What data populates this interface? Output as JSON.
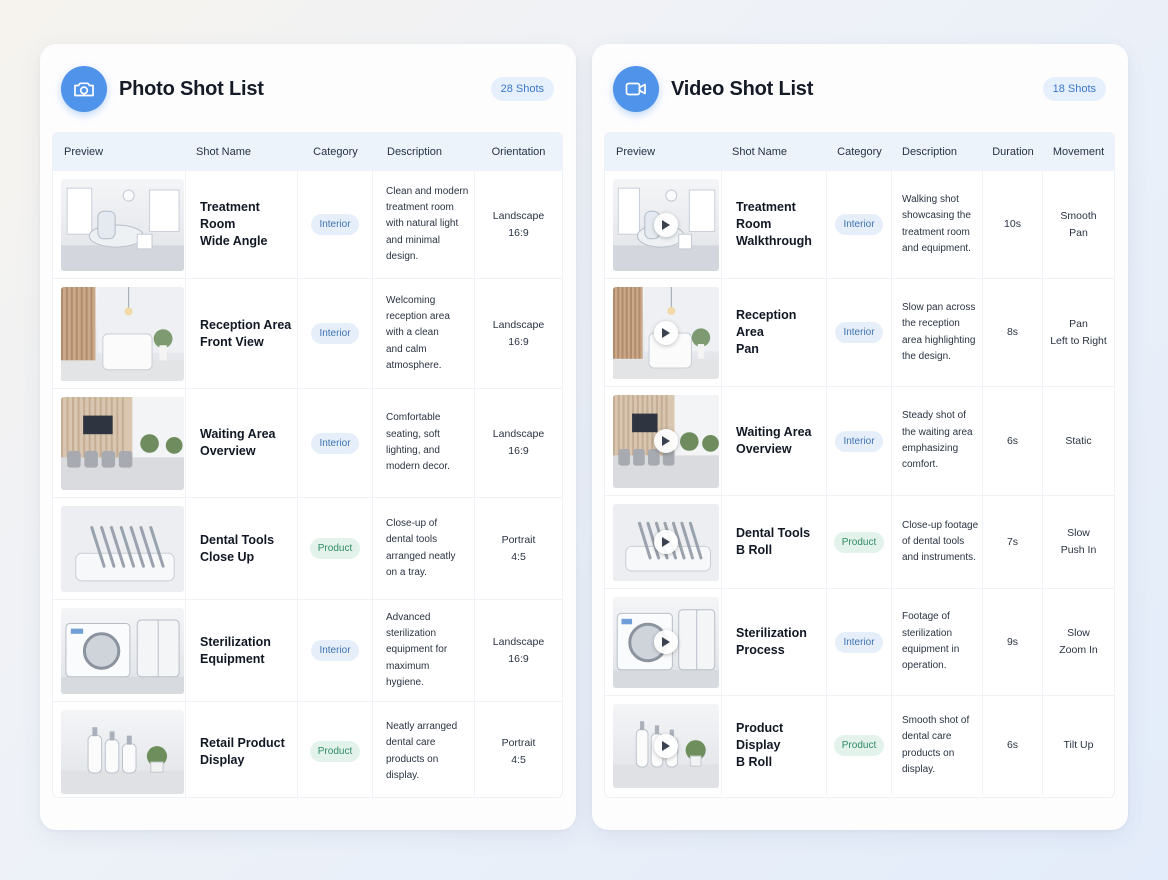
{
  "photo": {
    "title": "Photo Shot List",
    "count": "28 Shots",
    "icon": "camera-icon",
    "accent": "#4f93ea",
    "columns": [
      "Preview",
      "Shot Name",
      "Category",
      "Description",
      "Orientation"
    ],
    "rows": [
      {
        "name": "Treatment Room\nWide Angle",
        "category": "Interior",
        "description": "Clean and modern\ntreatment room\nwith natural light\nand minimal\ndesign.",
        "orientation": "Landscape\n16:9",
        "preview": "treatment-room-photo"
      },
      {
        "name": "Reception Area\nFront View",
        "category": "Interior",
        "description": "Welcoming\nreception area\nwith a clean\nand calm\natmosphere.",
        "orientation": "Landscape\n16:9",
        "preview": "reception-area-photo"
      },
      {
        "name": "Waiting Area\nOverview",
        "category": "Interior",
        "description": "Comfortable\nseating, soft\nlighting, and\nmodern decor.",
        "orientation": "Landscape\n16:9",
        "preview": "waiting-area-photo"
      },
      {
        "name": "Dental Tools\nClose Up",
        "category": "Product",
        "description": "Close-up of\ndental tools\narranged neatly\non a tray.",
        "orientation": "Portrait\n4:5",
        "preview": "dental-tools-photo"
      },
      {
        "name": "Sterilization\nEquipment",
        "category": "Interior",
        "description": "Advanced\nsterilization\nequipment for\nmaximum\nhygiene.",
        "orientation": "Landscape\n16:9",
        "preview": "sterilization-photo"
      },
      {
        "name": "Retail Product\nDisplay",
        "category": "Product",
        "description": "Neatly arranged\ndental care\nproducts on\ndisplay.",
        "orientation": "Portrait\n4:5",
        "preview": "retail-product-photo"
      }
    ]
  },
  "video": {
    "title": "Video Shot List",
    "count": "18 Shots",
    "icon": "video-camera-icon",
    "accent": "#4f93ea",
    "columns": [
      "Preview",
      "Shot Name",
      "Category",
      "Description",
      "Duration",
      "Movement"
    ],
    "rows": [
      {
        "name": "Treatment Room\nWalkthrough",
        "category": "Interior",
        "description": "Walking shot\nshowcasing the\ntreatment room\nand equipment.",
        "duration": "10s",
        "movement": "Smooth\nPan",
        "preview": "treatment-room-video"
      },
      {
        "name": "Reception Area\nPan",
        "category": "Interior",
        "description": "Slow pan across\nthe reception\narea highlighting\nthe design.",
        "duration": "8s",
        "movement": "Pan\nLeft to Right",
        "preview": "reception-area-video"
      },
      {
        "name": "Waiting Area\nOverview",
        "category": "Interior",
        "description": "Steady shot of\nthe waiting area\nemphasizing\ncomfort.",
        "duration": "6s",
        "movement": "Static",
        "preview": "waiting-area-video"
      },
      {
        "name": "Dental Tools\nB Roll",
        "category": "Product",
        "description": "Close-up footage\nof dental tools\nand instruments.",
        "duration": "7s",
        "movement": "Slow\nPush In",
        "preview": "dental-tools-video"
      },
      {
        "name": "Sterilization\nProcess",
        "category": "Interior",
        "description": "Footage of\nsterilization\nequipment in\noperation.",
        "duration": "9s",
        "movement": "Slow\nZoom In",
        "preview": "sterilization-video"
      },
      {
        "name": "Product Display\nB Roll",
        "category": "Product",
        "description": "Smooth shot of\ndental care\nproducts on\ndisplay.",
        "duration": "6s",
        "movement": "Tilt Up",
        "preview": "product-display-video"
      }
    ]
  }
}
